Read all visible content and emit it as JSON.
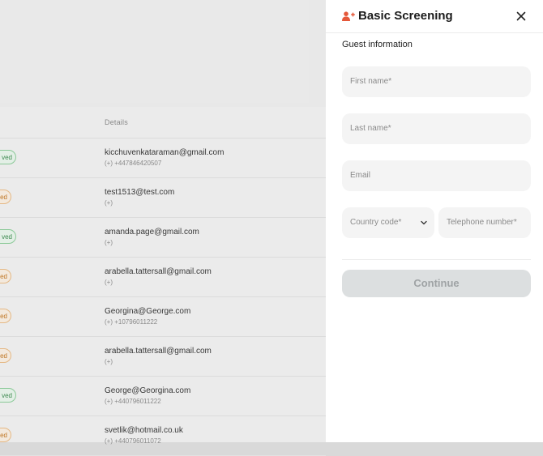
{
  "drawer": {
    "title": "Basic Screening",
    "section_label": "Guest information",
    "fields": {
      "first_name": "First name*",
      "last_name": "Last name*",
      "email": "Email",
      "country_code": "Country code*",
      "telephone": "Telephone number*"
    },
    "continue_label": "Continue",
    "icon": "user-plus-icon",
    "accent_color": "#e5583a"
  },
  "table": {
    "column_details": "Details",
    "rows": [
      {
        "status": "ved",
        "status_color": "green",
        "email": "kicchuvenkataraman@gmail.com",
        "phone": "(+) +447846420507"
      },
      {
        "status": "ed",
        "status_color": "orange",
        "email": "test1513@test.com",
        "phone": "(+)"
      },
      {
        "status": "ved",
        "status_color": "green",
        "email": "amanda.page@gmail.com",
        "phone": "(+)"
      },
      {
        "status": "ed",
        "status_color": "orange",
        "email": "arabella.tattersall@gmail.com",
        "phone": "(+)"
      },
      {
        "status": "ed",
        "status_color": "orange",
        "email": "Georgina@George.com",
        "phone": "(+) +10796011222"
      },
      {
        "status": "ed",
        "status_color": "orange",
        "email": "arabella.tattersall@gmail.com",
        "phone": "(+)"
      },
      {
        "status": "ved",
        "status_color": "green",
        "email": "George@Georgina.com",
        "phone": "(+) +440796011222"
      },
      {
        "status": "ed",
        "status_color": "orange",
        "email": "svetlik@hotmail.co.uk",
        "phone": "(+) +440796011072"
      }
    ]
  }
}
